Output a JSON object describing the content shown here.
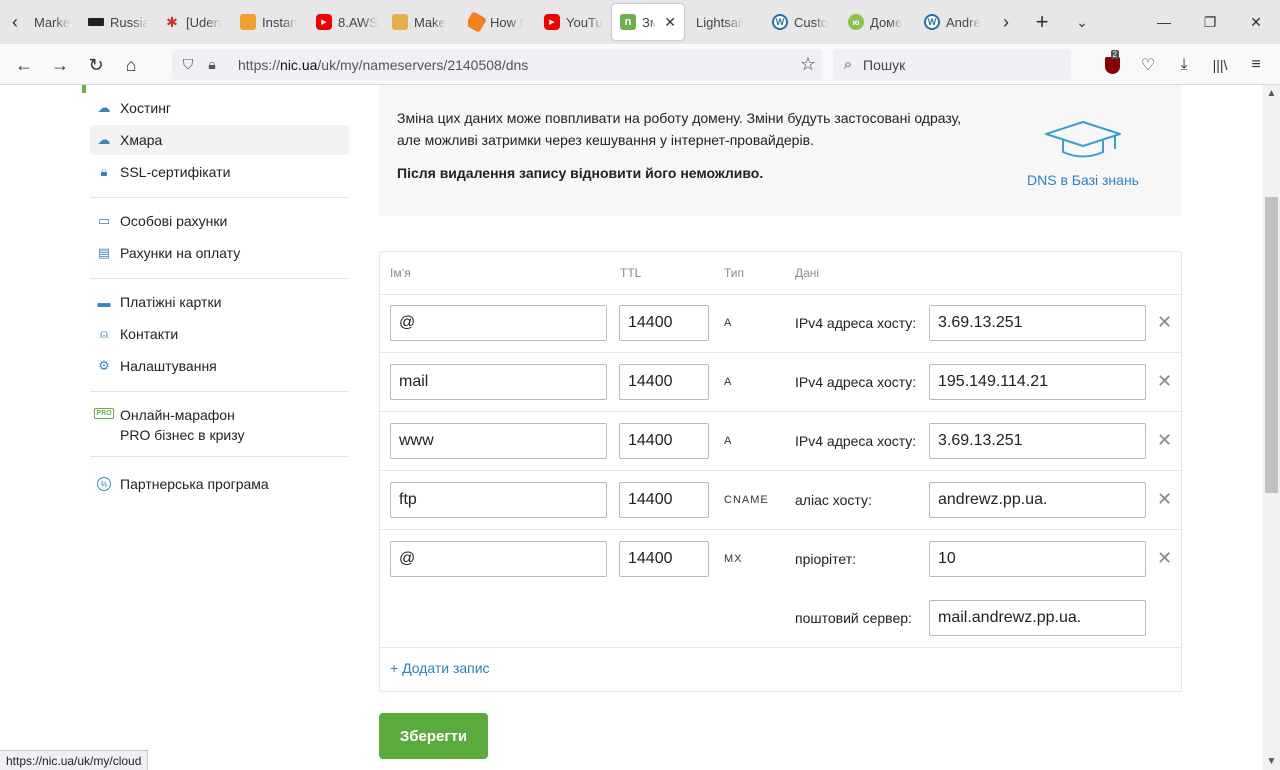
{
  "browser": {
    "tabs": [
      {
        "label": "Marke",
        "favicon": "tab-favicon-marke"
      },
      {
        "label": "Russia",
        "favicon": "tab-favicon-russia"
      },
      {
        "label": "[Uden",
        "favicon": "tab-favicon-udemy"
      },
      {
        "label": "Instan",
        "favicon": "tab-favicon-instance"
      },
      {
        "label": "8.AWS",
        "favicon": "youtube-icon"
      },
      {
        "label": "Make",
        "favicon": "tab-favicon-aws-box"
      },
      {
        "label": "How t",
        "favicon": "tab-favicon-aws-cube"
      },
      {
        "label": "YouTu",
        "favicon": "youtube-icon"
      },
      {
        "label": "Змі",
        "favicon": "nic-ua-icon",
        "active": true
      },
      {
        "label": "Lightsail",
        "favicon": ""
      },
      {
        "label": "Custo",
        "favicon": "wordpress-icon"
      },
      {
        "label": "Доме",
        "favicon": "tab-favicon-domain"
      },
      {
        "label": "Andre",
        "favicon": "wordpress-icon"
      }
    ],
    "url": {
      "prefix": "https://",
      "host": "nic.ua",
      "path": "/uk/my/nameservers/2140508/dns"
    },
    "search_placeholder": "Пошук",
    "ublock_count": "2",
    "status_url": "https://nic.ua/uk/my/cloud"
  },
  "sidebar": {
    "group1": [
      {
        "label": "Хостинг",
        "icon": "cloud-icon"
      },
      {
        "label": "Хмара",
        "icon": "cloud-server-icon",
        "active": true
      },
      {
        "label": "SSL-сертифікати",
        "icon": "lock-icon"
      }
    ],
    "group2": [
      {
        "label": "Особові рахунки",
        "icon": "wallet-icon"
      },
      {
        "label": "Рахунки на оплату",
        "icon": "invoice-icon"
      }
    ],
    "group3": [
      {
        "label": "Платіжні картки",
        "icon": "card-icon"
      },
      {
        "label": "Контакти",
        "icon": "user-icon"
      },
      {
        "label": "Налаштування",
        "icon": "gear-icon"
      }
    ],
    "promo": {
      "line1": "Онлайн-марафон",
      "line2": "PRO бізнес в кризу",
      "icon_text": "PRO"
    },
    "partner": {
      "label": "Партнерська програма",
      "icon": "percent-icon"
    }
  },
  "info": {
    "text": "Зміна цих даних може повпливати на роботу домену. Зміни будуть застосовані одразу, але можливі затримки через кешування у інтернет-провайдерів.",
    "warning": "Після видалення запису відновити його неможливо.",
    "kb_link": "DNS в Базі знань"
  },
  "table": {
    "headers": {
      "name": "Ім’я",
      "ttl": "TTL",
      "type": "Тип",
      "data": "Дані"
    },
    "records": [
      {
        "name": "@",
        "ttl": "14400",
        "type": "A",
        "data_label": "IPv4 адреса хосту:",
        "value": "3.69.13.251"
      },
      {
        "name": "mail",
        "ttl": "14400",
        "type": "A",
        "data_label": "IPv4 адреса хосту:",
        "value": "195.149.114.21"
      },
      {
        "name": "www",
        "ttl": "14400",
        "type": "A",
        "data_label": "IPv4 адреса хосту:",
        "value": "3.69.13.251"
      },
      {
        "name": "ftp",
        "ttl": "14400",
        "type": "CNAME",
        "data_label": "аліас хосту:",
        "value": "andrewz.pp.ua."
      },
      {
        "name": "@",
        "ttl": "14400",
        "type": "MX",
        "data_label": "пріорітет:",
        "value": "10",
        "extra_label": "поштовий сервер:",
        "extra_value": "mail.andrewz.pp.ua."
      }
    ],
    "add_record": "+ Додати запис"
  },
  "save_button": "Зберегти",
  "colors": {
    "accent_green": "#5aaa3c",
    "link_blue": "#2c82b9",
    "icon_blue": "#3b86b8"
  }
}
